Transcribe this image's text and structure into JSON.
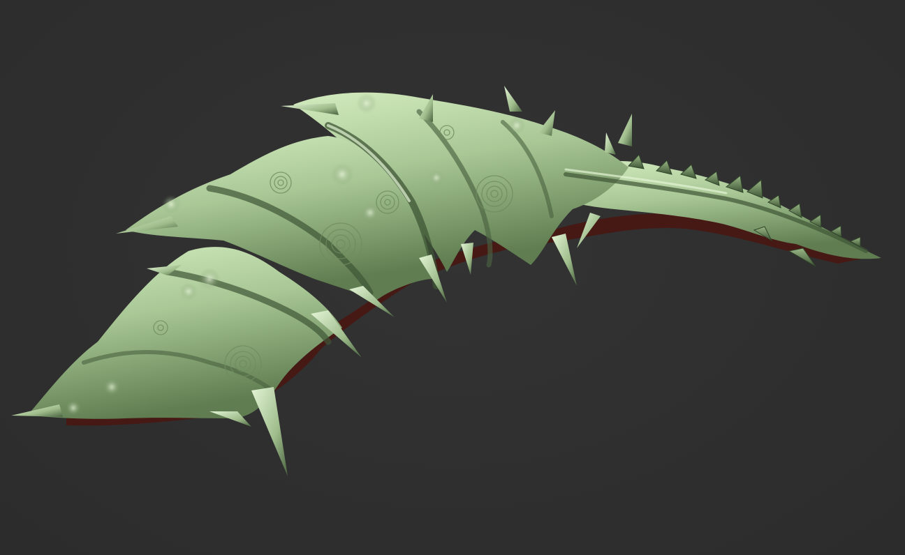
{
  "viewport": {
    "background_color": "#2f2f2f",
    "model": {
      "label": "",
      "base_color": "#a8c795",
      "highlight_color": "#d6edc2",
      "shadow_color": "#3d5233",
      "rim_color": "#5a1a12"
    }
  }
}
